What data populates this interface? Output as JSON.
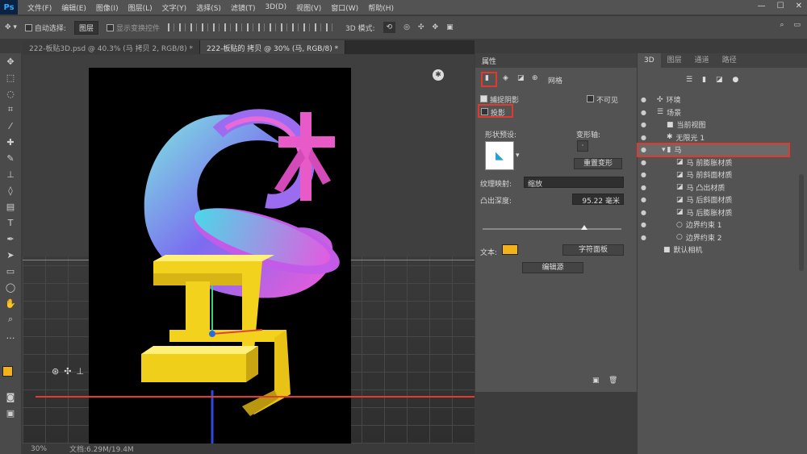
{
  "menubar": {
    "logo": "Ps",
    "items": [
      "文件(F)",
      "编辑(E)",
      "图像(I)",
      "图层(L)",
      "文字(Y)",
      "选择(S)",
      "滤镜(T)",
      "3D(D)",
      "视图(V)",
      "窗口(W)",
      "帮助(H)"
    ],
    "min_icon": "minimize-icon",
    "max_icon": "maximize-icon",
    "close_icon": "close-icon"
  },
  "options": {
    "auto_select": "自动选择:",
    "layer_dropdown": "图层",
    "transform_label": "显示变换控件",
    "mode3d": "3D 模式:"
  },
  "tabs": [
    {
      "label": "222-板贴3D.psd @ 40.3% (马 拷贝 2, RGB/8) *"
    },
    {
      "label": "222-板贴的 拷贝 @ 30% (马, RGB/8) *"
    }
  ],
  "status": {
    "zoom": "30%",
    "doc": "文档:6.29M/19.4M"
  },
  "props": {
    "tab": "属性",
    "toolbar_label": "网格",
    "catch_shadow": "捕捉阴影",
    "invisible": "不可见",
    "cast_shadow": "投影",
    "shape_preset": "形状预设:",
    "deform_axis": "变形轴:",
    "reset_deform": "重置变形",
    "texture_map": "纹理映射:",
    "texture_value": "缩放",
    "extrusion_depth": "凸出深度:",
    "extrusion_value": "95.22 毫米",
    "text_label": "文本:",
    "char_panel": "字符面板",
    "edit_source": "编辑源",
    "swatch_color": "#f3b21a"
  },
  "scene": {
    "tabs": [
      "3D",
      "图层",
      "通道",
      "路径"
    ],
    "rows": [
      {
        "label": "环境",
        "indent": 0
      },
      {
        "label": "场景",
        "indent": 0
      },
      {
        "label": "当前视图",
        "indent": 1
      },
      {
        "label": "无限光 1",
        "indent": 1
      },
      {
        "label": "马",
        "indent": 1
      },
      {
        "label": "马 前膨胀材质",
        "indent": 2
      },
      {
        "label": "马 前斜面材质",
        "indent": 2
      },
      {
        "label": "马 凸出材质",
        "indent": 2
      },
      {
        "label": "马 后斜面材质",
        "indent": 2
      },
      {
        "label": "马 后膨胀材质",
        "indent": 2
      },
      {
        "label": "边界约束 1",
        "indent": 2
      },
      {
        "label": "边界约束 2",
        "indent": 2
      },
      {
        "label": "默认相机",
        "indent": 0
      }
    ]
  },
  "artwork": {
    "large_char": "马",
    "small_char": "木"
  }
}
